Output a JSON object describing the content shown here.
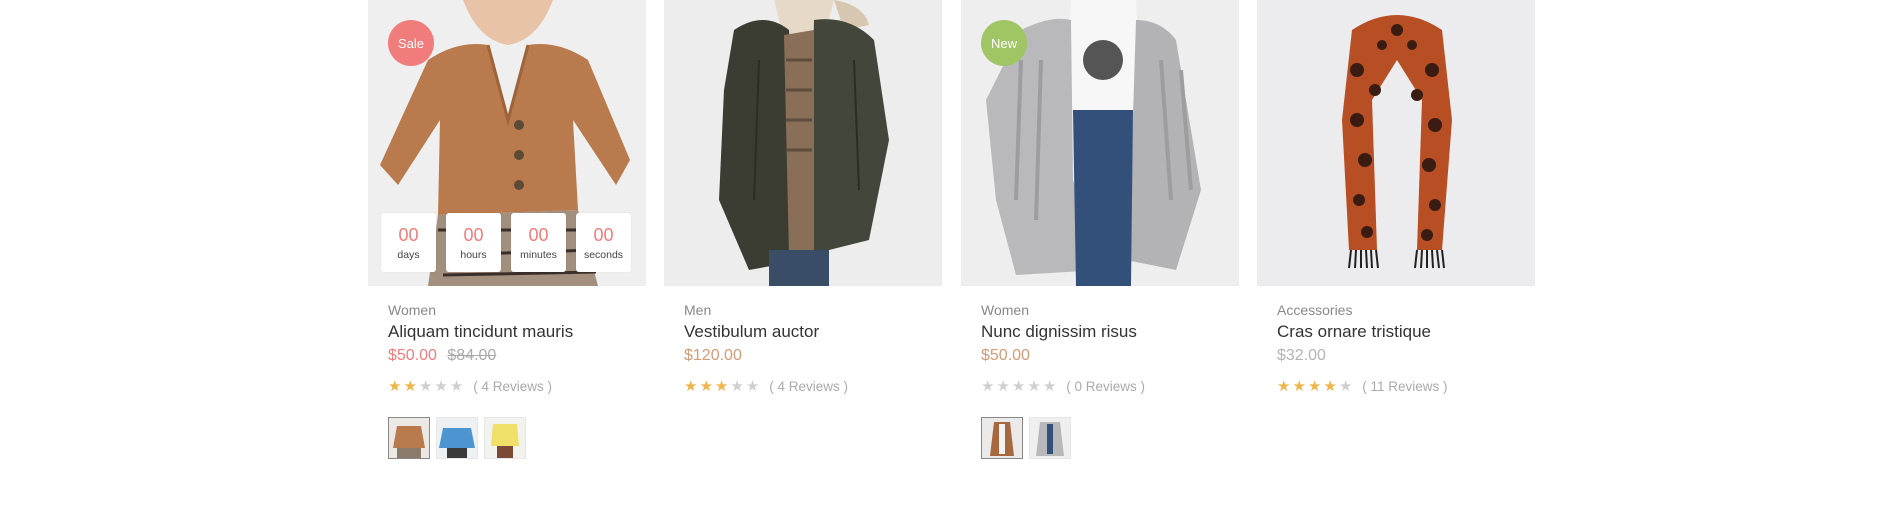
{
  "products": [
    {
      "category": "Women",
      "title": "Aliquam tincidunt mauris",
      "price": "$50.00",
      "old_price": "$84.00",
      "badge": "Sale",
      "rating": 2,
      "reviews": "( 4 Reviews )",
      "countdown": [
        {
          "value": "00",
          "unit": "days"
        },
        {
          "value": "00",
          "unit": "hours"
        },
        {
          "value": "00",
          "unit": "minutes"
        },
        {
          "value": "00",
          "unit": "seconds"
        }
      ],
      "swatches": [
        "brown-cardigan",
        "blue-sweater",
        "yellow-sweater"
      ]
    },
    {
      "category": "Men",
      "title": "Vestibulum auctor",
      "price": "$120.00",
      "rating": 3,
      "reviews": "( 4 Reviews )"
    },
    {
      "category": "Women",
      "title": "Nunc dignissim risus",
      "price": "$50.00",
      "badge": "New",
      "rating": 0,
      "reviews": "( 0 Reviews )",
      "swatches": [
        "brown-coat",
        "grey-cardigan"
      ]
    },
    {
      "category": "Accessories",
      "title": "Cras ornare tristique",
      "price": "$32.00",
      "rating": 4,
      "reviews": "( 11 Reviews )"
    }
  ],
  "colors": {
    "sale_badge": "#f07c7c",
    "new_badge": "#9fc565",
    "sale_price": "#f07c7c",
    "price": "#d59a76",
    "star": "#f0b54a"
  }
}
